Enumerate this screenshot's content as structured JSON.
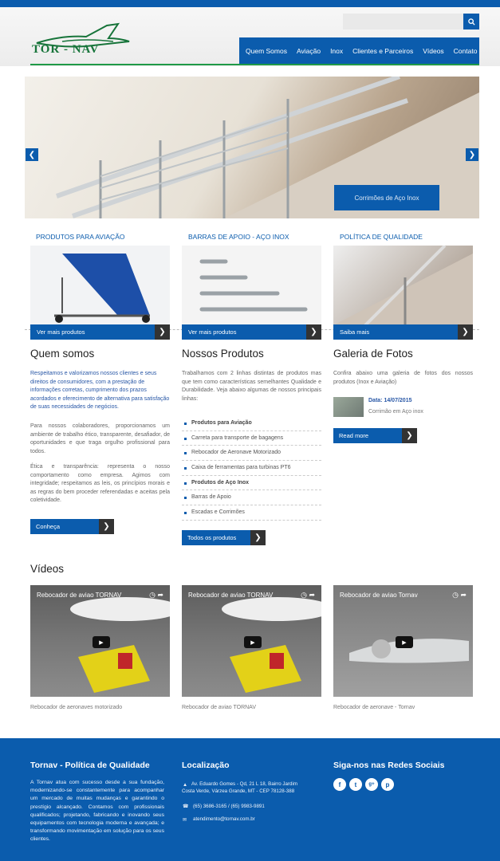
{
  "header": {
    "logo_text": "TOR - NAV",
    "search_placeholder": "",
    "nav": [
      "Quem Somos",
      "Aviação",
      "Inox",
      "Clientes e Parceiros",
      "Vídeos",
      "Contato"
    ]
  },
  "slider": {
    "caption": "Corrimões de Aço Inox"
  },
  "columns": [
    {
      "title": "PRODUTOS PARA AVIAÇÃO",
      "button": "Ver mais produtos"
    },
    {
      "title": "BARRAS DE APOIO - AÇO INOX",
      "button": "Ver mais produtos"
    },
    {
      "title": "POLÍTICA DE QUALIDADE",
      "button": "Saiba mais"
    }
  ],
  "quem_somos": {
    "title": "Quem somos",
    "intro": "Respeitamos e valorizamos nossos clientes e seus direitos de consumidores, com a prestação de informações corretas, cumprimento dos prazos acordados e oferecimento de alternativa para satisfação de suas necessidades de negócios.",
    "p1": "Para nossos colaboradores, proporcionamos um ambiente de trabalho ético, transparente, desafiador, de oportunidades e que traga orgulho profissional para todos.",
    "p2": "Ética e transparência: representa o nosso comportamento como empresa. Agimos com integridade; respeitamos as leis, os princípios morais e as regras do bem proceder referendadas e aceitas pela coletividade.",
    "button": "Conheça"
  },
  "produtos": {
    "title": "Nossos Produtos",
    "text": "Trabalhamos com 2 linhas distintas de produtos mas que tem como características semelhantes Qualidade e Durabilidade. Veja abaixo algumas de nossos principais linhas:",
    "items": [
      {
        "label": "Produtos para Aviação",
        "strong": true
      },
      {
        "label": "Carreta para transporte de bagagens",
        "strong": false
      },
      {
        "label": "Rebocador de Aeronave Motorizado",
        "strong": false
      },
      {
        "label": "Caixa de ferramentas para turbinas PT6",
        "strong": false
      },
      {
        "label": "Produtos de Aço Inox",
        "strong": true
      },
      {
        "label": "Barras de Apoio",
        "strong": false
      },
      {
        "label": "Escadas e Corrimões",
        "strong": false
      }
    ],
    "button": "Todos os produtos"
  },
  "galeria": {
    "title": "Galeria de Fotos",
    "text": "Confira abaixo uma galeria de fotos dos nossos produtos (Inox e Aviação)",
    "date": "Data: 14/07/2015",
    "item": "Corrimão em Aço inox",
    "button": "Read more"
  },
  "videos": {
    "title": "Vídeos",
    "items": [
      {
        "title": "Rebocador de aviao TORNAV",
        "caption": "Rebocador de aeronaves motorizado"
      },
      {
        "title": "Rebocador de aviao TORNAV",
        "caption": "Rebocador de aviao TORNAV"
      },
      {
        "title": "Rebocador de aviao Tornav",
        "caption": "Rebocador de aeronave - Tornav"
      }
    ]
  },
  "footer": {
    "col1_title": "Tornav - Política de Qualidade",
    "col1_text": "A Tornav atua com sucesso desde a sua fundação, modernizando-se constantemente para acompanhar um mercado de muitas mudanças e garantindo o prestígio alcançado. Contamos com profissionais qualificados; projetando, fabricando e inovando seus equipamentos com tecnologia moderna e avançada; e transformando movimentação em solução para os seus clientes.",
    "col2_title": "Localização",
    "address1": "Av. Eduardo Gomes - Qd, 21 L 18, Bairro Jardim",
    "address2": "Costa Verde, Várzea Grande, MT - CEP 78128-388",
    "phone": "(65) 3686-3165 / (65) 9983-9891",
    "email": "atendimento@tornav.com.br",
    "col3_title": "Siga-nos nas Redes Sociais",
    "social": [
      "f",
      "t",
      "g+",
      "p"
    ]
  }
}
